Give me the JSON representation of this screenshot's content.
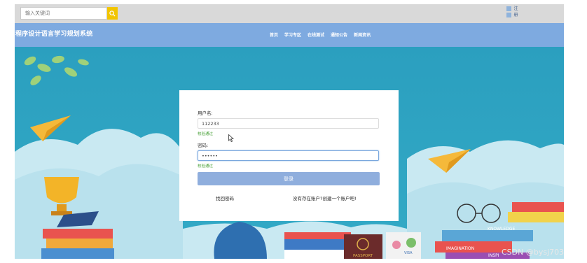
{
  "search": {
    "placeholder": "输入关键词"
  },
  "top_right": {
    "line1": "注",
    "line2": "册"
  },
  "header": {
    "title": "程序设计语言学习规划系统"
  },
  "nav": [
    "首页",
    "学习专区",
    "在线测试",
    "通知公告",
    "新闻资讯"
  ],
  "form": {
    "username_label": "用户名:",
    "username_value": "112233",
    "username_hint": "校验通过",
    "password_label": "密码:",
    "password_value": "••••••",
    "password_hint": "校验通过",
    "login_label": "登录",
    "forgot_link": "找回密码",
    "register_link": "没有存在账户?创建一个账户吧!"
  },
  "illustration": {
    "ribbon_text": "KNOWLEDGE",
    "book_text": "IMAGINATION",
    "book2_text": "INSPI",
    "passport_text": "PASSPORT",
    "visa_text": "VISA"
  },
  "watermark": "CSDN @bysj703",
  "colors": {
    "header": "#7eaae0",
    "background": "#2aa2c0",
    "search_button": "#f2c500",
    "button": "#8faedd",
    "hint": "#4aa23a"
  }
}
